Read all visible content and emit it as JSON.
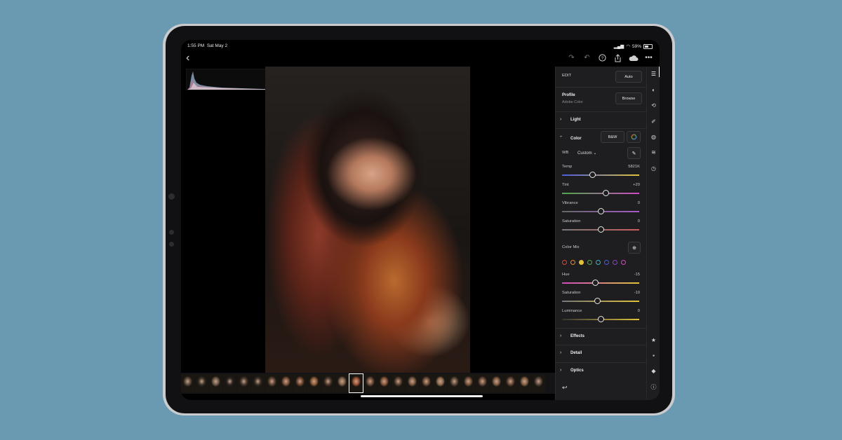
{
  "status": {
    "time": "1:55 PM",
    "date": "Sat May 2",
    "battery": "59%"
  },
  "topbar": {
    "back_icon": "chevron-left-icon",
    "icons": [
      "redo-icon",
      "undo-icon",
      "help-icon",
      "share-icon",
      "cloud-sync-icon",
      "more-icon"
    ]
  },
  "filmstrip": {
    "count": 26,
    "selected_index": 12
  },
  "panel": {
    "edit_label": "EDIT",
    "auto_label": "Auto",
    "profile_label": "Profile",
    "profile_value": "Adobe Color",
    "browse_label": "Browse",
    "sections": {
      "light": "Light",
      "color": "Color",
      "effects": "Effects",
      "detail": "Detail",
      "optics": "Optics"
    },
    "bw_label": "B&W",
    "wb_label": "WB",
    "wb_value": "Custom",
    "sliders": [
      {
        "label": "Temp",
        "value": "5821K",
        "pos": 0.39
      },
      {
        "label": "Tint",
        "value": "+20",
        "pos": 0.56
      },
      {
        "label": "Vibrance",
        "value": "0",
        "pos": 0.5
      },
      {
        "label": "Saturation",
        "value": "0",
        "pos": 0.5
      }
    ],
    "color_mix_label": "Color Mix",
    "color_mix_dots": [
      "#e0463c",
      "#e88a2c",
      "#e3c23a",
      "#4ea84a",
      "#38b3c8",
      "#4a5de0",
      "#8a44d0",
      "#d04ac0"
    ],
    "mix_sliders": [
      {
        "label": "Hue",
        "value": "-15",
        "pos": 0.43
      },
      {
        "label": "Saturation",
        "value": "-10",
        "pos": 0.45
      },
      {
        "label": "Luminance",
        "value": "0",
        "pos": 0.5
      }
    ]
  },
  "rail": {
    "top_icons": [
      "edit-sliders-icon",
      "presets-icon",
      "crop-icon",
      "healing-icon",
      "masking-icon",
      "versions-icon",
      "history-icon"
    ],
    "bottom_icons": [
      "star-icon",
      "comment-icon",
      "tag-icon",
      "info-icon"
    ]
  },
  "colors": {
    "accent": "#e3c23a",
    "panel_bg": "#1e1e20",
    "background": "#6a9ab2"
  }
}
